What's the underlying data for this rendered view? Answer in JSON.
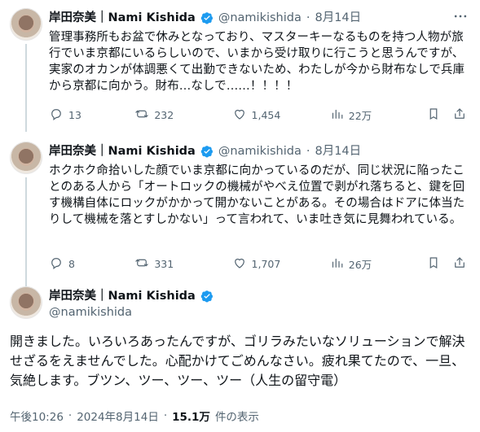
{
  "tweets": [
    {
      "name": "岸田奈美｜Nami Kishida",
      "handle": "@namikishida",
      "sep": "·",
      "date": "8月14日",
      "text": "管理事務所もお盆で休みとなっており、マスターキーなるものを持つ人物が旅行でいま京都にいるらしいので、いまから受け取りに行こうと思うんですが、実家のオカンが体調悪くて出勤できないため、わたしが今から財布なしで兵庫から京都に向かう。財布…なしで……！！！！",
      "replies": "13",
      "reposts": "232",
      "likes": "1,454",
      "views": "22万"
    },
    {
      "name": "岸田奈美｜Nami Kishida",
      "handle": "@namikishida",
      "sep": "·",
      "date": "8月14日",
      "text": "ホクホク命拾いした顔でいま京都に向かっているのだが、同じ状況に陥ったことのある人から「オートロックの機械がやべえ位置で剥がれ落ちると、鍵を回す機構自体にロックがかかって開かないことがある。その場合はドアに体当たりして機械を落とすしかない」って言われて、いま吐き気に見舞われている。",
      "replies": "8",
      "reposts": "331",
      "likes": "1,707",
      "views": "26万"
    }
  ],
  "main_tweet": {
    "name": "岸田奈美｜Nami Kishida",
    "handle": "@namikishida",
    "text": "開きました。いろいろあったんですが、ゴリラみたいなソリューションで解決せざるをえませんでした。心配かけてごめんなさい。疲れ果てたので、一旦、気絶します。ブツン、ツー、ツー、ツー（人生の留守電）",
    "time": "午後10:26",
    "sep": "·",
    "date": "2024年8月14日",
    "sep2": "·",
    "views_count": "15.1万",
    "views_label": "件の表示"
  },
  "icons": {
    "verified": "verified-badge-icon",
    "more": "more-icon",
    "reply": "reply-icon",
    "repost": "repost-icon",
    "like": "like-icon",
    "views": "views-icon",
    "bookmark": "bookmark-icon",
    "share": "share-icon"
  },
  "colors": {
    "accent": "#1d9bf0",
    "muted": "#536471",
    "text": "#0f1419",
    "thread_line": "#cfd9de"
  }
}
